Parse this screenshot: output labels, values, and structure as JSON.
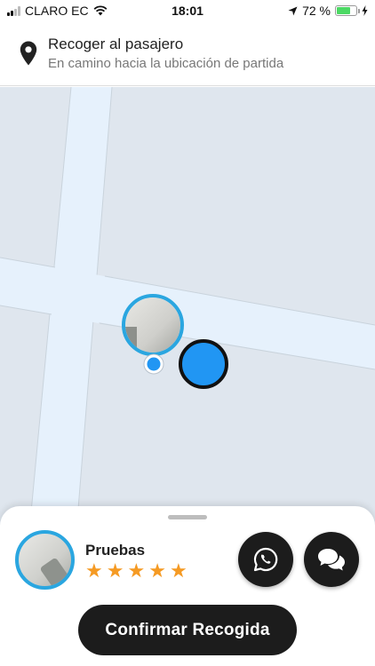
{
  "status_bar": {
    "carrier": "CLARO EC",
    "time": "18:01",
    "battery_percent": "72 %",
    "battery_level": 0.72,
    "icons": [
      "signal-bars-icon",
      "wifi-icon",
      "location-arrow-icon",
      "battery-icon",
      "charging-bolt-icon"
    ]
  },
  "header": {
    "title": "Recoger al pasajero",
    "subtitle": "En camino hacia la ubicación de partida",
    "icon": "map-pin-icon"
  },
  "map": {
    "markers": [
      "passenger-photo-marker",
      "current-location-dot",
      "driver-marker"
    ],
    "colors": {
      "background": "#dfe6ee",
      "road": "#e6f1fc",
      "accent": "#2196f3",
      "photo_ring": "#2aa6e0"
    }
  },
  "sheet": {
    "passenger_name": "Pruebas",
    "rating": 5,
    "rating_max": 5,
    "whatsapp_icon": "whatsapp-icon",
    "chat_icon": "chat-bubbles-icon",
    "confirm_label": "Confirmar Recogida"
  },
  "colors": {
    "button_dark": "#1c1c1c",
    "star": "#f59a23",
    "battery": "#4cd964"
  }
}
